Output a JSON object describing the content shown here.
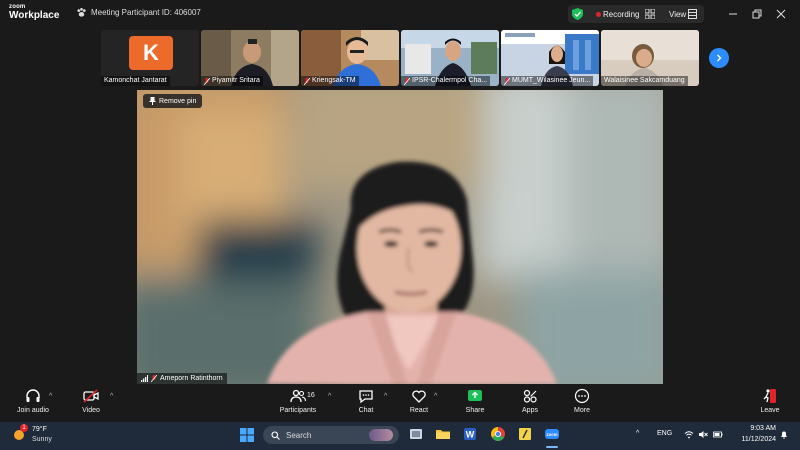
{
  "window": {
    "brand_small": "zoom",
    "brand_big": "Workplace",
    "meeting_id": "Meeting Participant ID: 406007",
    "recording_label": "Recording",
    "view_label": "View"
  },
  "filmstrip": {
    "participants": [
      {
        "name": "Kamonchat Jantarat",
        "avatar_letter": "K",
        "muted": false
      },
      {
        "name": "Piyamitr Sritara",
        "muted": true
      },
      {
        "name": "Kriengsak-TM",
        "muted": true
      },
      {
        "name": "IPSR-Chalermpol Cha...",
        "muted": true
      },
      {
        "name": "MUMT_Wilasinee Jeun...",
        "muted": true
      },
      {
        "name": "Walaisinee Sakcamduang",
        "muted": false
      }
    ],
    "next_icon": "chevron-right-icon"
  },
  "main": {
    "pin_label": "Remove pin",
    "speaker_name": "Ameporn Ratinthorn"
  },
  "toolbar": {
    "join_audio": "Join audio",
    "video": "Video",
    "participants": "Participants",
    "participants_count": "16",
    "chat": "Chat",
    "react": "React",
    "share": "Share",
    "apps": "Apps",
    "more": "More",
    "leave": "Leave"
  },
  "taskbar": {
    "weather_temp": "79°F",
    "weather_desc": "Sunny",
    "weather_badge": "1",
    "search_placeholder": "Search",
    "language": "ENG",
    "time": "9:03 AM",
    "date": "11/12/2024"
  },
  "colors": {
    "accent_blue": "#2d8cff",
    "share_green": "#1cbf5a",
    "recording_red": "#e0242a",
    "avatar_orange": "#ec6a2a",
    "leave_red": "#e0242a"
  }
}
